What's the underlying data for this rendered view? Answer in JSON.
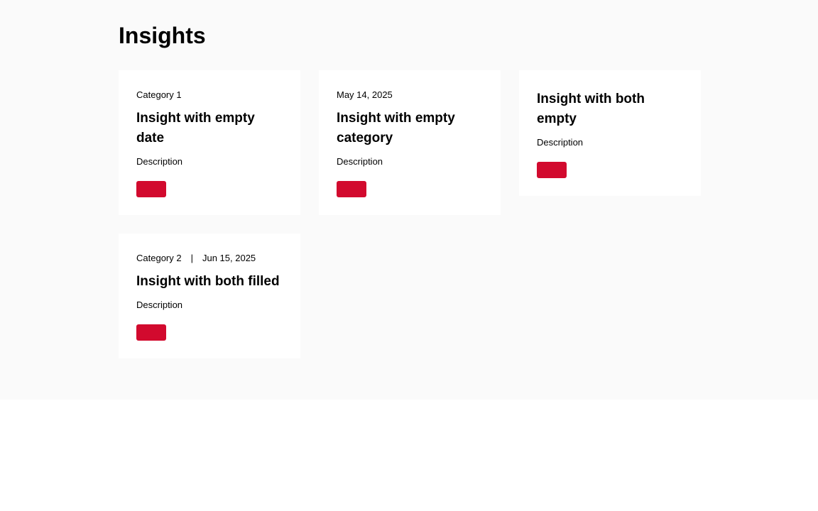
{
  "page": {
    "title": "Insights"
  },
  "colors": {
    "section_bg": "#fafafa",
    "card_bg": "#ffffff",
    "accent": "#d20a2e",
    "text": "#000000"
  },
  "cards": [
    {
      "category": "Category 1",
      "date": "",
      "title": "Insight with empty date",
      "description": "Description",
      "button_label": ""
    },
    {
      "category": "",
      "date": "May 14, 2025",
      "title": "Insight with empty category",
      "description": "Description",
      "button_label": ""
    },
    {
      "category": "",
      "date": "",
      "title": "Insight with both empty",
      "description": "Description",
      "button_label": ""
    },
    {
      "category": "Category 2",
      "separator": "|",
      "date": "Jun 15, 2025",
      "title": "Insight with both filled",
      "description": "Description",
      "button_label": ""
    }
  ]
}
